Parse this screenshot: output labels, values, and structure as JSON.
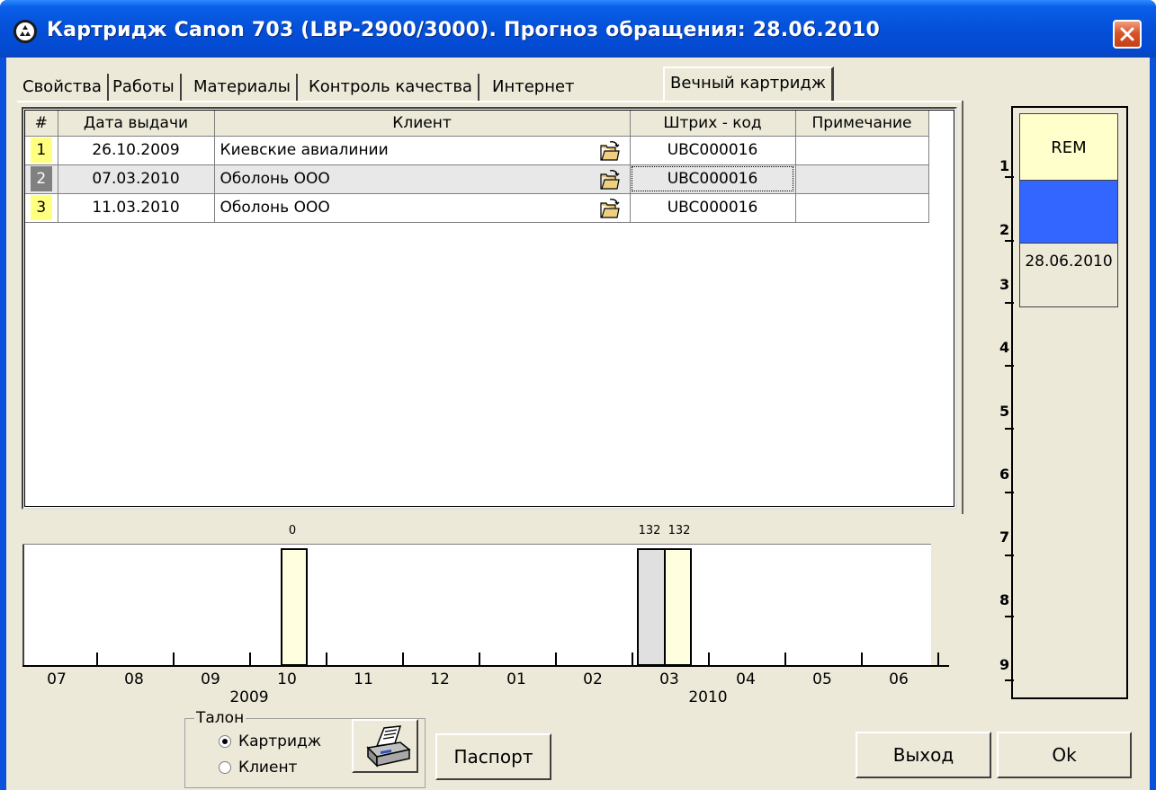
{
  "window": {
    "title": "Картридж Canon 703 (LBP-2900/3000). Прогноз обращения: 28.06.2010"
  },
  "tabs": [
    {
      "label": "Свойства"
    },
    {
      "label": "Работы"
    },
    {
      "label": "Материалы"
    },
    {
      "label": "Контроль качества"
    },
    {
      "label": "Интернет"
    },
    {
      "label": "Вечный картридж"
    }
  ],
  "grid": {
    "columns": [
      "#",
      "Дата выдачи",
      "Клиент",
      "Штрих - код",
      "Примечание"
    ],
    "rows": [
      {
        "num": "1",
        "date": "26.10.2009",
        "client": "Киевские авиалинии",
        "barcode": "UBC000016",
        "note": ""
      },
      {
        "num": "2",
        "date": "07.03.2010",
        "client": "Оболонь ООО",
        "barcode": "UBC000016",
        "note": ""
      },
      {
        "num": "3",
        "date": "11.03.2010",
        "client": "Оболонь ООО",
        "barcode": "UBC000016",
        "note": ""
      }
    ]
  },
  "timeline": {
    "months": [
      "07",
      "08",
      "09",
      "10",
      "11",
      "12",
      "01",
      "02",
      "03",
      "04",
      "05",
      "06"
    ],
    "years": [
      "2009",
      "2010"
    ],
    "bar_labels": [
      "0",
      "132",
      "132"
    ]
  },
  "talon": {
    "title": "Талон",
    "options": [
      "Картридж",
      "Клиент"
    ],
    "selected": "Картридж"
  },
  "buttons": {
    "passport": "Паспорт",
    "exit": "Выход",
    "ok": "Ok"
  },
  "side_panel": {
    "scale": [
      "1",
      "2",
      "3",
      "4",
      "5",
      "6",
      "7",
      "8",
      "9"
    ],
    "rem_label": "REM",
    "forecast_date": "28.06.2010"
  },
  "colors": {
    "row_highlight_num": "#ffff80",
    "row_selected_num": "#808080",
    "bar_light": "#ffffe0",
    "bar_gray": "#e0e0e0",
    "rem_blue": "#3366ff",
    "rem_cream": "#ffffcc"
  }
}
